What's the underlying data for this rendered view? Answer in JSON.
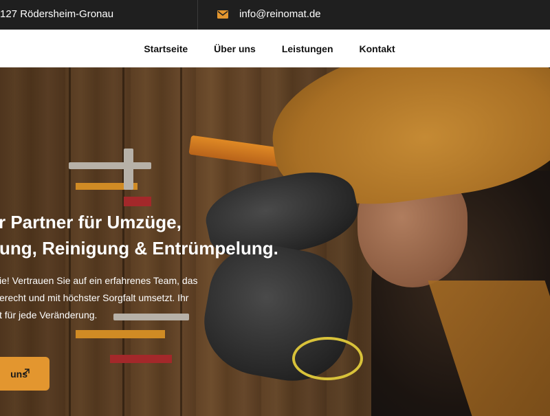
{
  "topbar": {
    "address": "127 Rödersheim-Gronau",
    "email": "info@reinomat.de",
    "icons": {
      "email": "envelope-icon"
    },
    "accent_color": "#e3962f"
  },
  "nav": {
    "items": [
      "Startseite",
      "Über uns",
      "Leistungen",
      "Kontakt"
    ]
  },
  "hero": {
    "headline": [
      "r Partner für Umzüge,",
      "ung, Reinigung & Entrümpelung."
    ],
    "paragraph": [
      "ie! Vertrauen Sie auf ein erfahrenes Team, das",
      "erecht und mit höchster Sorgfalt umsetzt. Ihr",
      "t für jede Veränderung."
    ],
    "cta": {
      "label": "uns",
      "icon": "arrow-up-right-icon"
    },
    "background_image": "worker-laying-floor-tiles-photo"
  }
}
